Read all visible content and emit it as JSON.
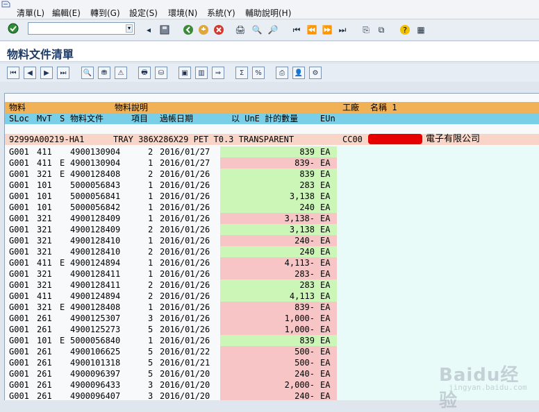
{
  "menu": [
    "清單(L)",
    "編輯(E)",
    "轉到(G)",
    "設定(S)",
    "環境(N)",
    "系統(Y)",
    "輔助說明(H)"
  ],
  "toolbar": {
    "command_value": "",
    "buttons": [
      "enter-icon",
      "command-dropdown-icon",
      "back-left-icon",
      "save-icon",
      "back-icon",
      "exit-icon",
      "cancel-icon",
      "print-icon",
      "find-icon",
      "find-next-icon",
      "first-page-icon",
      "prev-page-icon",
      "next-page-icon",
      "last-page-icon",
      "new-session-icon",
      "shortcut-icon",
      "help-icon",
      "layout-icon"
    ]
  },
  "page_title": "物料文件清單",
  "app_toolbar": {
    "buttons": [
      "first-item-icon",
      "prev-item-icon",
      "next-item-icon",
      "last-item-icon",
      "details-icon",
      "filter-icon",
      "sort-icon",
      "print-preview-icon",
      "filter2-icon",
      "select-layout-icon",
      "columns-icon",
      "export-icon",
      "sum-icon",
      "subtotal-icon",
      "save-layout-icon",
      "user-icon",
      "graphic-icon"
    ]
  },
  "header_row1": {
    "material": "物料",
    "material_desc": "物料說明",
    "plant": "工廠",
    "name": "名稱 1"
  },
  "header_row2": {
    "sloc": "SLoc",
    "mvt": "MvT",
    "s": "S",
    "mat_doc": "物料文件",
    "item": "項目",
    "posting_date": "過帳日期",
    "qty": "以 UnE 計的數量",
    "eun": "EUn"
  },
  "material": {
    "number": "92999A00219-HA1",
    "description": "TRAY 386X286X29 PET T0.3 TRANSPARENT",
    "plant": "CC00",
    "company_suffix": "電子有限公司"
  },
  "rows": [
    {
      "sloc": "G001",
      "mvt": "411",
      "s": "",
      "doc": "4900130904",
      "item": "2",
      "date": "2016/01/27",
      "qty": "839",
      "eun": "EA",
      "neg": false
    },
    {
      "sloc": "G001",
      "mvt": "411",
      "s": "E",
      "doc": "4900130904",
      "item": "1",
      "date": "2016/01/27",
      "qty": "839-",
      "eun": "EA",
      "neg": true
    },
    {
      "sloc": "G001",
      "mvt": "321",
      "s": "E",
      "doc": "4900128408",
      "item": "2",
      "date": "2016/01/26",
      "qty": "839",
      "eun": "EA",
      "neg": false
    },
    {
      "sloc": "G001",
      "mvt": "101",
      "s": "",
      "doc": "5000056843",
      "item": "1",
      "date": "2016/01/26",
      "qty": "283",
      "eun": "EA",
      "neg": false
    },
    {
      "sloc": "G001",
      "mvt": "101",
      "s": "",
      "doc": "5000056841",
      "item": "1",
      "date": "2016/01/26",
      "qty": "3,138",
      "eun": "EA",
      "neg": false
    },
    {
      "sloc": "G001",
      "mvt": "101",
      "s": "",
      "doc": "5000056842",
      "item": "1",
      "date": "2016/01/26",
      "qty": "240",
      "eun": "EA",
      "neg": false
    },
    {
      "sloc": "G001",
      "mvt": "321",
      "s": "",
      "doc": "4900128409",
      "item": "1",
      "date": "2016/01/26",
      "qty": "3,138-",
      "eun": "EA",
      "neg": true
    },
    {
      "sloc": "G001",
      "mvt": "321",
      "s": "",
      "doc": "4900128409",
      "item": "2",
      "date": "2016/01/26",
      "qty": "3,138",
      "eun": "EA",
      "neg": false
    },
    {
      "sloc": "G001",
      "mvt": "321",
      "s": "",
      "doc": "4900128410",
      "item": "1",
      "date": "2016/01/26",
      "qty": "240-",
      "eun": "EA",
      "neg": true
    },
    {
      "sloc": "G001",
      "mvt": "321",
      "s": "",
      "doc": "4900128410",
      "item": "2",
      "date": "2016/01/26",
      "qty": "240",
      "eun": "EA",
      "neg": false
    },
    {
      "sloc": "G001",
      "mvt": "411",
      "s": "E",
      "doc": "4900124894",
      "item": "1",
      "date": "2016/01/26",
      "qty": "4,113-",
      "eun": "EA",
      "neg": true
    },
    {
      "sloc": "G001",
      "mvt": "321",
      "s": "",
      "doc": "4900128411",
      "item": "1",
      "date": "2016/01/26",
      "qty": "283-",
      "eun": "EA",
      "neg": true
    },
    {
      "sloc": "G001",
      "mvt": "321",
      "s": "",
      "doc": "4900128411",
      "item": "2",
      "date": "2016/01/26",
      "qty": "283",
      "eun": "EA",
      "neg": false
    },
    {
      "sloc": "G001",
      "mvt": "411",
      "s": "",
      "doc": "4900124894",
      "item": "2",
      "date": "2016/01/26",
      "qty": "4,113",
      "eun": "EA",
      "neg": false
    },
    {
      "sloc": "G001",
      "mvt": "321",
      "s": "E",
      "doc": "4900128408",
      "item": "1",
      "date": "2016/01/26",
      "qty": "839-",
      "eun": "EA",
      "neg": true
    },
    {
      "sloc": "G001",
      "mvt": "261",
      "s": "",
      "doc": "4900125307",
      "item": "3",
      "date": "2016/01/26",
      "qty": "1,000-",
      "eun": "EA",
      "neg": true
    },
    {
      "sloc": "G001",
      "mvt": "261",
      "s": "",
      "doc": "4900125273",
      "item": "5",
      "date": "2016/01/26",
      "qty": "1,000-",
      "eun": "EA",
      "neg": true
    },
    {
      "sloc": "G001",
      "mvt": "101",
      "s": "E",
      "doc": "5000056840",
      "item": "1",
      "date": "2016/01/26",
      "qty": "839",
      "eun": "EA",
      "neg": false
    },
    {
      "sloc": "G001",
      "mvt": "261",
      "s": "",
      "doc": "4900106625",
      "item": "5",
      "date": "2016/01/22",
      "qty": "500-",
      "eun": "EA",
      "neg": true
    },
    {
      "sloc": "G001",
      "mvt": "261",
      "s": "",
      "doc": "4900101318",
      "item": "5",
      "date": "2016/01/21",
      "qty": "500-",
      "eun": "EA",
      "neg": true
    },
    {
      "sloc": "G001",
      "mvt": "261",
      "s": "",
      "doc": "4900096397",
      "item": "5",
      "date": "2016/01/20",
      "qty": "240-",
      "eun": "EA",
      "neg": true
    },
    {
      "sloc": "G001",
      "mvt": "261",
      "s": "",
      "doc": "4900096433",
      "item": "3",
      "date": "2016/01/20",
      "qty": "2,000-",
      "eun": "EA",
      "neg": true
    },
    {
      "sloc": "G001",
      "mvt": "261",
      "s": "",
      "doc": "4900096407",
      "item": "3",
      "date": "2016/01/20",
      "qty": "240-",
      "eun": "EA",
      "neg": true
    }
  ],
  "watermark": {
    "main": "Baidu经验",
    "sub": "jingyan.baidu.com"
  }
}
